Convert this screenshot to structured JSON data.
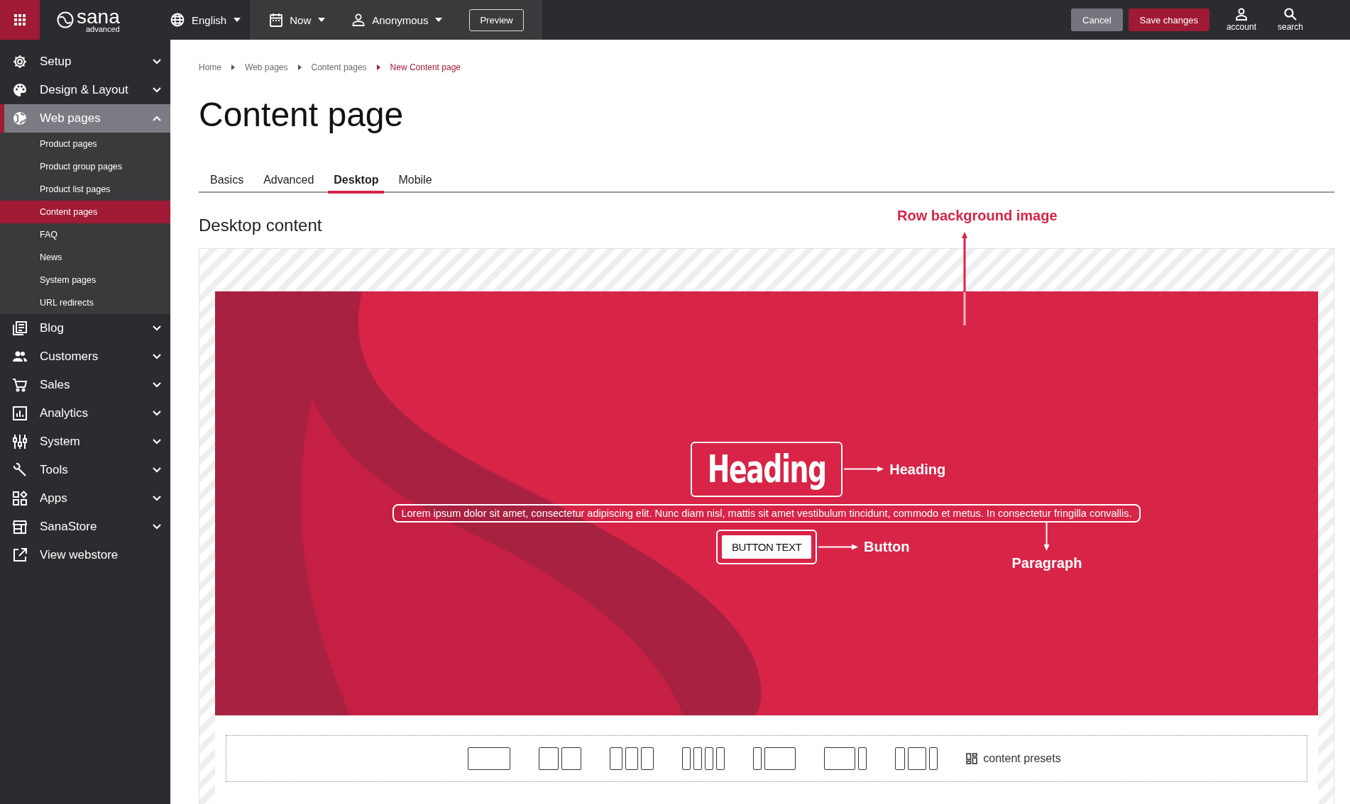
{
  "topbar": {
    "logo": "sana",
    "logo_sub": "advanced",
    "language": "English",
    "date": "Now",
    "user": "Anonymous",
    "preview": "Preview",
    "cancel": "Cancel",
    "save": "Save changes",
    "account": "account",
    "search": "search"
  },
  "sidebar": {
    "items": [
      {
        "label": "Setup",
        "expanded": false,
        "selected": false
      },
      {
        "label": "Design & Layout",
        "expanded": false,
        "selected": false
      },
      {
        "label": "Web pages",
        "expanded": true,
        "selected": true,
        "children": [
          {
            "label": "Product pages",
            "selected": false
          },
          {
            "label": "Product group pages",
            "selected": false
          },
          {
            "label": "Product list pages",
            "selected": false
          },
          {
            "label": "Content pages",
            "selected": true
          },
          {
            "label": "FAQ",
            "selected": false
          },
          {
            "label": "News",
            "selected": false
          },
          {
            "label": "System pages",
            "selected": false
          },
          {
            "label": "URL redirects",
            "selected": false
          }
        ]
      },
      {
        "label": "Blog",
        "expanded": false,
        "selected": false
      },
      {
        "label": "Customers",
        "expanded": false,
        "selected": false
      },
      {
        "label": "Sales",
        "expanded": false,
        "selected": false
      },
      {
        "label": "Analytics",
        "expanded": false,
        "selected": false
      },
      {
        "label": "System",
        "expanded": false,
        "selected": false
      },
      {
        "label": "Tools",
        "expanded": false,
        "selected": false
      },
      {
        "label": "Apps",
        "expanded": false,
        "selected": false
      },
      {
        "label": "SanaStore",
        "expanded": false,
        "selected": false
      },
      {
        "label": "View webstore",
        "selected": false
      }
    ]
  },
  "breadcrumb": [
    {
      "label": "Home",
      "current": false
    },
    {
      "label": "Web pages",
      "current": false
    },
    {
      "label": "Content pages",
      "current": false
    },
    {
      "label": "New Content page",
      "current": true
    }
  ],
  "title": "Content page",
  "tabs": [
    {
      "label": "Basics",
      "selected": false
    },
    {
      "label": "Advanced",
      "selected": false
    },
    {
      "label": "Desktop",
      "selected": true
    },
    {
      "label": "Mobile",
      "selected": false
    }
  ],
  "section_title": "Desktop content",
  "canvas": {
    "row_background_label": "Row background image",
    "heading": "Heading",
    "heading_label": "Heading",
    "paragraph": "Lorem ipsum dolor sit amet, consectetur adipiscing elit. Nunc diam nisl, mattis sit amet vestibulum tincidunt, commodo et metus. In consectetur fringilla convallis.",
    "paragraph_label": "Paragraph",
    "button_text": "BUTTON TEXT",
    "button_label": "Button"
  },
  "presets": {
    "label": "content presets"
  }
}
